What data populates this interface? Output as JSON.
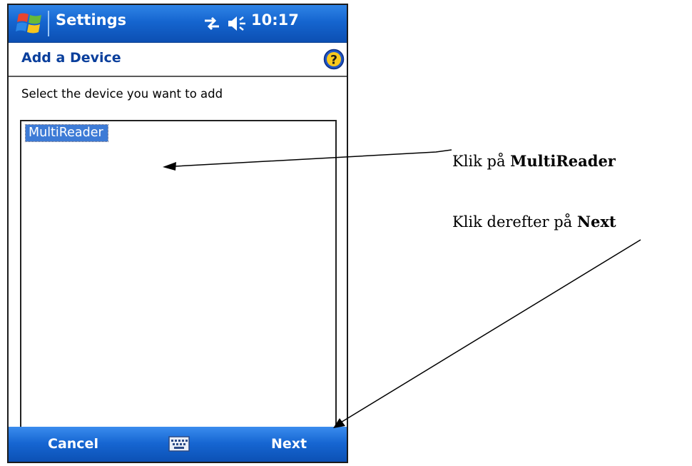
{
  "titlebar": {
    "app_title": "Settings",
    "clock": "10:17"
  },
  "page": {
    "title": "Add a Device",
    "instruction": "Select the device you want to add",
    "devices": [
      {
        "label": "MultiReader",
        "selected": true
      }
    ]
  },
  "softkeys": {
    "left": "Cancel",
    "right": "Next"
  },
  "annotations": {
    "step1_prefix": "Klik på ",
    "step1_bold": "MultiReader",
    "step2_prefix": "Klik derefter på ",
    "step2_bold": "Next"
  },
  "icons": {
    "start": "windows-flag-icon",
    "connectivity": "connectivity-icon",
    "volume": "speaker-icon",
    "help": "help-icon",
    "keyboard": "keyboard-icon"
  },
  "colors": {
    "titlebar_blue": "#1565cf",
    "header_text": "#0a3f9c",
    "selection": "#3d7bd6"
  }
}
